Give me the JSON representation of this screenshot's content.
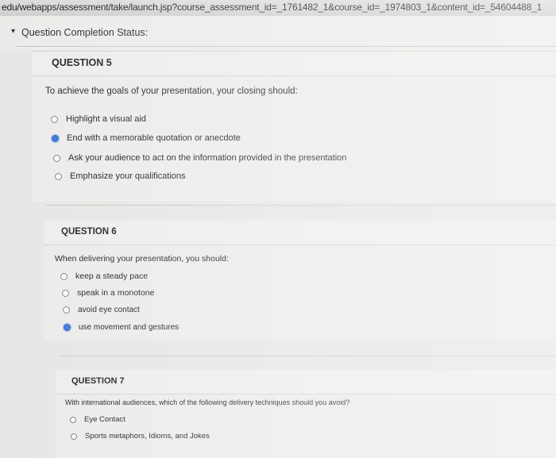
{
  "browser": {
    "url": "edu/webapps/assessment/take/launch.jsp?course_assessment_id=_1761482_1&course_id=_1974803_1&content_id=_54604488_1"
  },
  "status": {
    "label": "Question Completion Status:",
    "caret": "▾"
  },
  "questions": [
    {
      "title": "QUESTION 5",
      "text": "To achieve the goals of your presentation, your closing should:",
      "options": [
        {
          "label": "Highlight a visual aid",
          "selected": false
        },
        {
          "label": "End with a memorable quotation or anecdote",
          "selected": true
        },
        {
          "label": "Ask your audience to act on the information provided in the presentation",
          "selected": false
        },
        {
          "label": "Emphasize your qualifications",
          "selected": false
        }
      ]
    },
    {
      "title": "QUESTION 6",
      "text": "When delivering your presentation, you should:",
      "options": [
        {
          "label": "keep a steady pace",
          "selected": false
        },
        {
          "label": "speak in a monotone",
          "selected": false
        },
        {
          "label": "avoid eye contact",
          "selected": false
        },
        {
          "label": "use movement and gestures",
          "selected": true
        }
      ]
    },
    {
      "title": "QUESTION 7",
      "text": "With international audiences, which of the following delivery techniques should you avoid?",
      "options": [
        {
          "label": "Eye Contact",
          "selected": false
        },
        {
          "label": "Sports metaphors, Idioms, and Jokes",
          "selected": false
        }
      ]
    }
  ],
  "colors": {
    "selected_radio": "#3a78d6",
    "page_bg": "#e7e6e4"
  }
}
